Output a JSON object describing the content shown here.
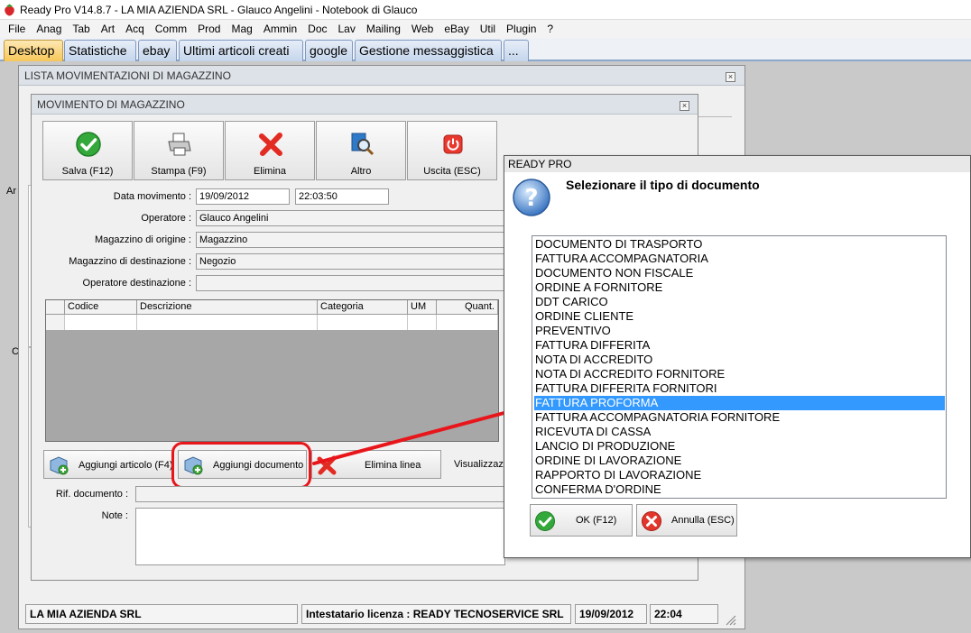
{
  "titlebar": {
    "title": "Ready Pro V14.8.7 - LA MIA AZIENDA SRL - Glauco Angelini - Notebook di Glauco",
    "icon": "strawberry-icon"
  },
  "menu": [
    "File",
    "Anag",
    "Tab",
    "Art",
    "Acq",
    "Comm",
    "Prod",
    "Mag",
    "Ammin",
    "Doc",
    "Lav",
    "Mailing",
    "Web",
    "eBay",
    "Util",
    "Plugin",
    "?"
  ],
  "tabs": [
    "Desktop",
    "Statistiche",
    "ebay",
    "Ultimi articoli creati",
    "google",
    "Gestione messaggistica",
    "..."
  ],
  "list_window": {
    "title": "LISTA MOVIMENTAZIONI DI MAGAZZINO"
  },
  "movement_window": {
    "title": "MOVIMENTO DI MAGAZZINO",
    "toolbar": {
      "save": "Salva (F12)",
      "print": "Stampa (F9)",
      "delete": "Elimina",
      "other": "Altro",
      "exit": "Uscita (ESC)"
    },
    "fields": {
      "date_label": "Data movimento :",
      "date_value": "19/09/2012",
      "time_value": "22:03:50",
      "operator_label": "Operatore :",
      "operator_value": "Glauco Angelini",
      "origin_label": "Magazzino di origine :",
      "origin_value": "Magazzino",
      "dest_label": "Magazzino di destinazione :",
      "dest_value": "Negozio",
      "dest_operator_label": "Operatore destinazione :",
      "dest_operator_value": ""
    },
    "grid_headers": [
      "Codice",
      "Descrizione",
      "Categoria",
      "UM",
      "Quant."
    ],
    "buttons": {
      "add_article": "Aggiungi articolo (F4)",
      "add_document": "Aggiungi documento",
      "delete_line": "Elimina linea",
      "view": "Visualizzazi"
    },
    "rif_label": "Rif. documento :",
    "note_label": "Note :"
  },
  "dialog": {
    "title": "READY PRO",
    "question": "Selezionare il tipo di documento",
    "selected_index": 11,
    "options": [
      "DOCUMENTO DI TRASPORTO",
      "FATTURA ACCOMPAGNATORIA",
      "DOCUMENTO NON FISCALE",
      "ORDINE A FORNITORE",
      "DDT CARICO",
      "ORDINE CLIENTE",
      "PREVENTIVO",
      "FATTURA DIFFERITA",
      "NOTA DI ACCREDITO",
      "NOTA DI ACCREDITO FORNITORE",
      "FATTURA DIFFERITA FORNITORI",
      "FATTURA PROFORMA",
      "FATTURA ACCOMPAGNATORIA FORNITORE",
      "RICEVUTA DI CASSA",
      "LANCIO DI PRODUZIONE",
      "ORDINE DI LAVORAZIONE",
      "RAPPORTO DI LAVORAZIONE",
      "CONFERMA D'ORDINE"
    ],
    "ok": "OK (F12)",
    "cancel": "Annulla (ESC)"
  },
  "background_fragments": {
    "a": "Ar",
    "c": "C"
  },
  "statusbar": {
    "company": "LA MIA AZIENDA SRL",
    "license": "Intestatario licenza : READY TECNOSERVICE SRL",
    "date": "19/09/2012",
    "time": "22:04"
  },
  "colors": {
    "selection": "#3399ff",
    "annotation": "#e8161b",
    "active_tab": "#f6c659"
  }
}
